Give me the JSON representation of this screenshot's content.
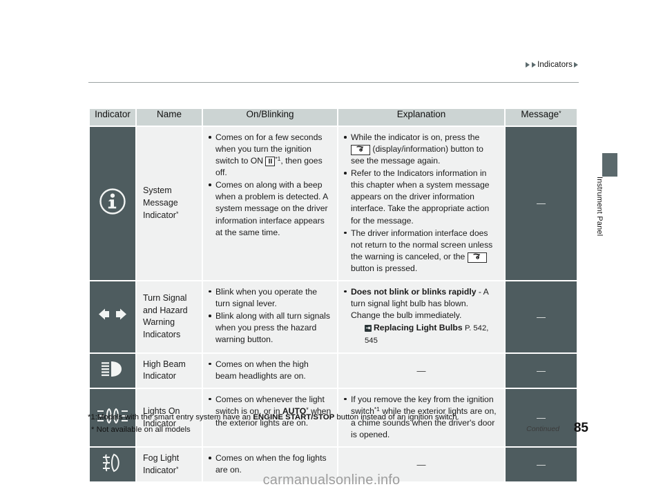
{
  "header": {
    "breadcrumb": "Indicators"
  },
  "side_tab": {
    "label": "Instrument Panel"
  },
  "table": {
    "columns": [
      {
        "label": "Indicator"
      },
      {
        "label": "Name"
      },
      {
        "label": "On/Blinking"
      },
      {
        "label": "Explanation"
      },
      {
        "label": "Message"
      }
    ],
    "message_superscript": "*",
    "rows": [
      {
        "icon": "info-circle-icon",
        "name": "System Message Indicator",
        "name_superscript": "*",
        "on_blinking": [
          "Comes on for a few seconds when you turn the ignition switch to ON",
          "Comes on along with a beep when a problem is detected. A system message on the driver information interface appears at the same time."
        ],
        "on_blinking_inline_box": "II",
        "on_blinking_inline_sup": "*1",
        "on_blinking_inline_tail": ", then goes off.",
        "explanation": [
          "While the indicator is on, press the",
          "(display/information) button to see the message again.",
          "Refer to the Indicators information in this chapter when a system message appears on the driver information interface. Take the appropriate action for the message.",
          "The driver information interface does not return to the normal screen unless the warning is canceled, or the",
          "button is pressed."
        ],
        "message": "—"
      },
      {
        "icon": "turn-signal-arrows-icon",
        "name": "Turn Signal and Hazard Warning Indicators",
        "on_blinking": [
          "Blink when you operate the turn signal lever.",
          "Blink along with all turn signals when you press the hazard warning button."
        ],
        "explanation_bold": "Does not blink or blinks rapidly",
        "explanation_rest": "- A turn signal light bulb has blown. Change the bulb immediately.",
        "explanation_ref": "Replacing Light Bulbs",
        "explanation_ref_page": "P. 542, 545",
        "message": "—"
      },
      {
        "icon": "high-beam-icon",
        "name": "High Beam Indicator",
        "on_blinking": [
          "Comes on when the high beam headlights are on."
        ],
        "explanation_dash": "—",
        "message": "—"
      },
      {
        "icon": "lights-on-icon",
        "name": "Lights On Indicator",
        "on_blinking_pre": "Comes on whenever the light switch is on, or in",
        "on_blinking_bold": "AUTO",
        "on_blinking_sup": "*",
        "on_blinking_post": "when the exterior lights are on.",
        "explanation": [
          "If you remove the key from the ignition switch"
        ],
        "explanation_sup": "*1",
        "explanation_tail": "while the exterior lights are on, a chime sounds when the driver's door is opened.",
        "message": "—"
      },
      {
        "icon": "fog-light-icon",
        "name": "Fog Light Indicator",
        "name_superscript": "*",
        "on_blinking": [
          "Comes on when the fog lights are on."
        ],
        "explanation_dash": "—",
        "message": "—"
      }
    ]
  },
  "footnotes": {
    "line1_pre": "*1:Models with the smart entry system have an",
    "line1_bold": "ENGINE START/STOP",
    "line1_post": "button instead of an ignition switch.",
    "line2": "* Not available on all models"
  },
  "footer": {
    "continued": "Continued",
    "page_number": "85"
  },
  "watermark": {
    "text": "carmanualsonline.info"
  },
  "colors": {
    "dark_cell": "#4e5c5f",
    "header_cell": "#ccd4d3",
    "light_cell": "#f0f1f1"
  }
}
